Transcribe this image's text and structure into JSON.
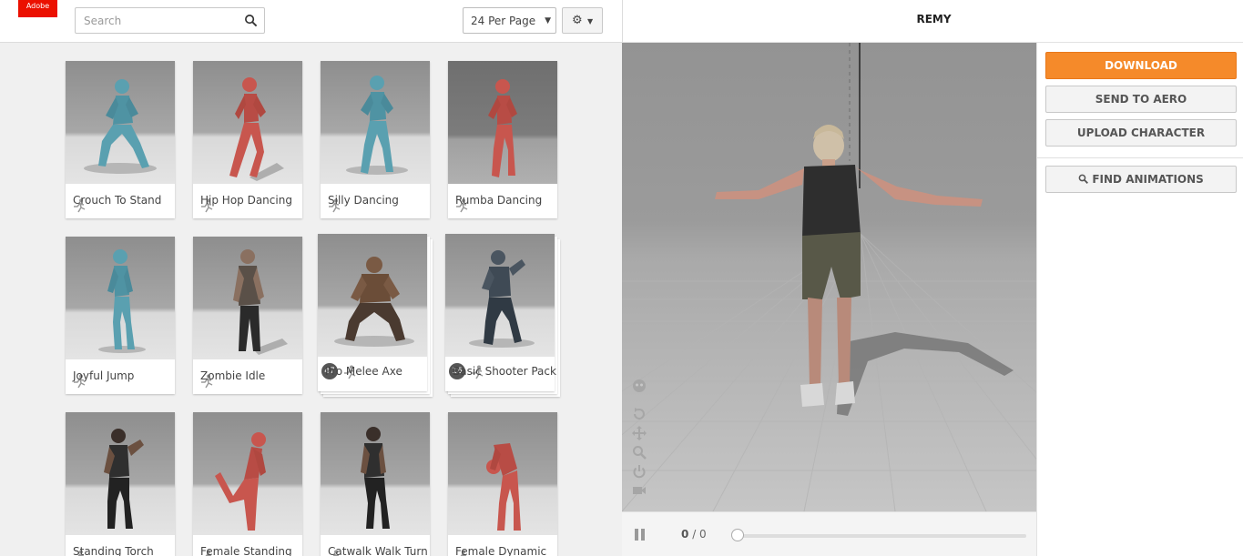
{
  "brand": {
    "logo_text": "Adobe",
    "accent": "#eb1000"
  },
  "search": {
    "placeholder": "Search"
  },
  "toolbar": {
    "per_page": "24 Per Page"
  },
  "gallery": {
    "cards": [
      {
        "label": "Crouch To Stand"
      },
      {
        "label": "Hip Hop Dancing"
      },
      {
        "label": "Silly Dancing"
      },
      {
        "label": "Rumba Dancing"
      },
      {
        "label": "Joyful Jump"
      },
      {
        "label": "Zombie Idle"
      },
      {
        "label": "Pro Melee Axe",
        "count": "47"
      },
      {
        "label": "Basic Shooter Pack",
        "count": "16"
      },
      {
        "label": "Standing Torch"
      },
      {
        "label": "Female Standing"
      },
      {
        "label": "Catwalk Walk Turn"
      },
      {
        "label": "Female Dynamic"
      }
    ]
  },
  "viewer": {
    "character_name": "REMY",
    "frame_current": "0",
    "frame_total": "/ 0"
  },
  "actions": {
    "download": "DOWNLOAD",
    "send_to_aero": "SEND TO AERO",
    "upload_character": "UPLOAD CHARACTER",
    "find_animations": "FIND ANIMATIONS"
  },
  "colors": {
    "download": "#f58a2a",
    "mannequin_blue": "#5aa0b0",
    "mannequin_red": "#c8564e"
  }
}
